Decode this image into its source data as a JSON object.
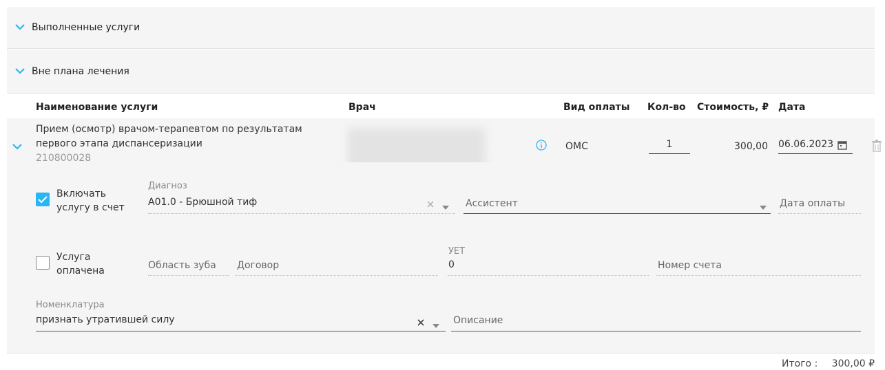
{
  "sections": {
    "completed": "Выполненные услуги",
    "off_plan": "Вне плана лечения"
  },
  "table": {
    "headers": {
      "name": "Наименование услуги",
      "doctor": "Врач",
      "payment": "Вид оплаты",
      "qty": "Кол-во",
      "cost": "Стоимость, ₽",
      "date": "Дата"
    },
    "row": {
      "name_line1": "Прием (осмотр) врачом-терапевтом по результатам",
      "name_line2": "первого этапа диспансеризации",
      "code": "210800028",
      "payment": "ОМС",
      "qty": "1",
      "cost": "300,00",
      "date": "06.06.2023"
    }
  },
  "detail": {
    "include_label1": "Включать",
    "include_label2": "услугу в счет",
    "include_checked": true,
    "diagnosis_label": "Диагноз",
    "diagnosis_value": "A01.0 - Брюшной тиф",
    "assistant_placeholder": "Ассистент",
    "pay_date_placeholder": "Дата оплаты",
    "paid_label1": "Услуга",
    "paid_label2": "оплачена",
    "paid_checked": false,
    "tooth_area_placeholder": "Область зуба",
    "contract_placeholder": "Договор",
    "uet_label": "УЕТ",
    "uet_value": "0",
    "invoice_placeholder": "Номер счета",
    "nomenclature_label": "Номенклатура",
    "nomenclature_value": "признать утратившей силу",
    "description_placeholder": "Описание"
  },
  "summary": {
    "total_label": "Итого :",
    "total_value": "300,00 ₽"
  },
  "colors": {
    "accent": "#29b6f6",
    "panel": "#f5f5f5"
  }
}
